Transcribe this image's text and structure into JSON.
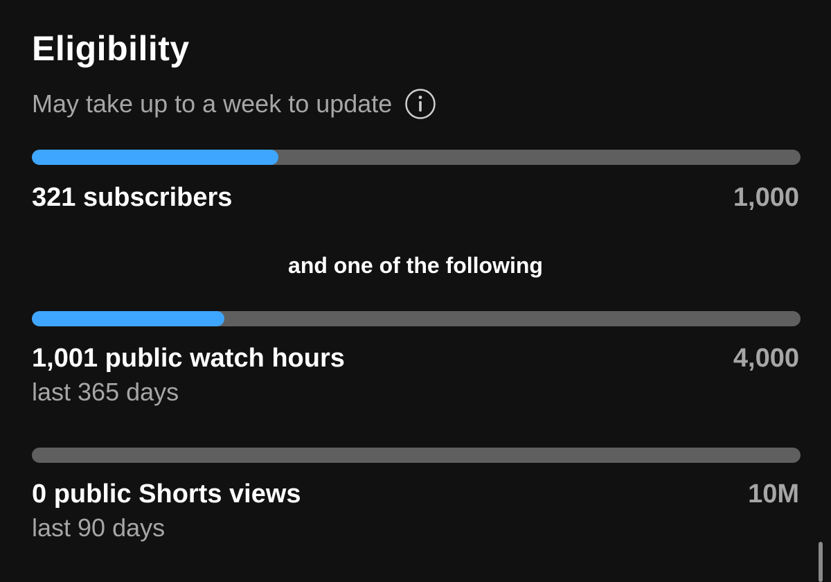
{
  "header": {
    "title": "Eligibility",
    "subtitle": "May take up to a week to update",
    "info_icon": "info-circle-icon"
  },
  "colors": {
    "background": "#111111",
    "progress_fill": "#3ea6ff",
    "progress_track": "#5f5f5f",
    "secondary_text": "#a6a6a6"
  },
  "requirements": {
    "subscribers": {
      "label": "321 subscribers",
      "target": "1,000",
      "progress": 0.321
    },
    "separator": "and one of the following",
    "watch_hours": {
      "label": "1,001 public watch hours",
      "period": "last 365 days",
      "target": "4,000",
      "progress": 0.25
    },
    "shorts_views": {
      "label": "0 public Shorts views",
      "period": "last 90 days",
      "target": "10M",
      "progress": 0
    }
  }
}
